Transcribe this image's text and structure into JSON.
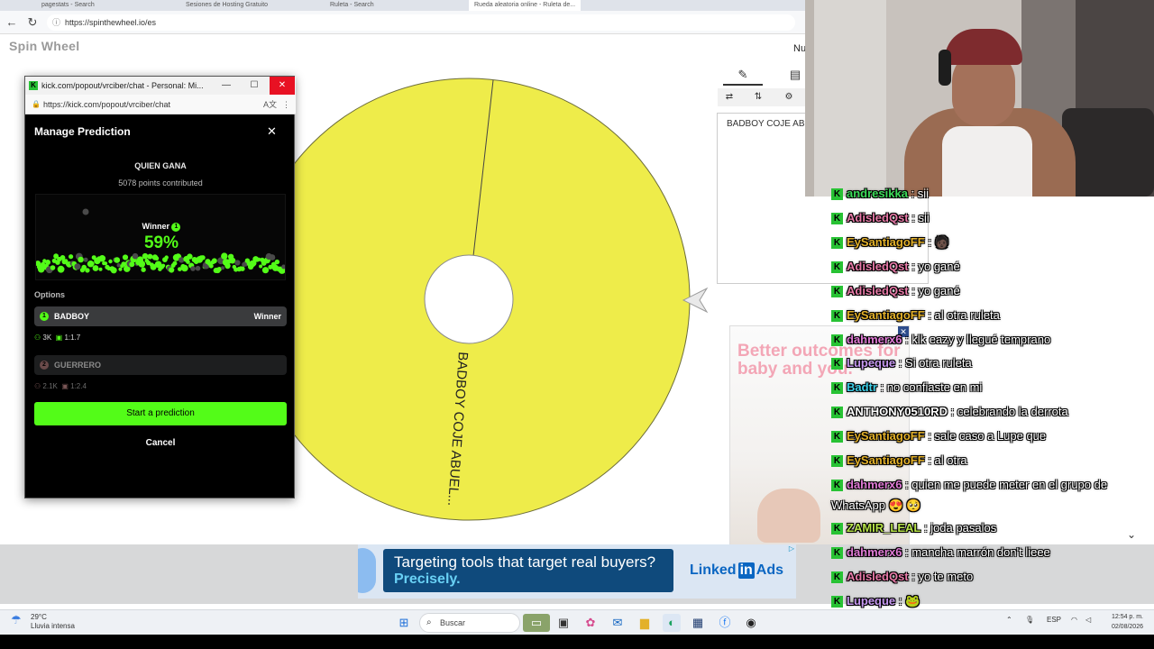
{
  "browser": {
    "url": "https://spinthewheel.io/es",
    "tabs": [
      "pagestats - Search",
      "Sesiones de Hosting Gratuito",
      "Ruleta - Search",
      "Rueda aleatoria online - Ruleta de..."
    ]
  },
  "page": {
    "logo": "Spin Wheel",
    "header_right": "Nu",
    "wheel_segment_label": "BADBOY COJE ABUEL...",
    "entries_text": "BADBOY COJE ABU",
    "wheel_color": "#eeec4a"
  },
  "popout": {
    "window_title": "kick.com/popout/vrciber/chat - Personal: Mi...",
    "address": "https://kick.com/popout/vrciber/chat",
    "heading": "Manage Prediction",
    "question": "QUIEN GANA",
    "points": "5078 points contributed",
    "winner_label": "Winner",
    "winner_badge": "1",
    "percent": "59%",
    "options_label": "Options",
    "options": [
      {
        "badge": "1",
        "name": "BADBOY",
        "status": "Winner",
        "users": "3K",
        "ratio": "1:1.7"
      },
      {
        "badge": "2",
        "name": "GUERRERO",
        "status": "",
        "users": "2.1K",
        "ratio": "1:2.4"
      }
    ],
    "start_button": "Start a prediction",
    "cancel_button": "Cancel",
    "accent": "#53fc18"
  },
  "ads": {
    "right_text": "Better outcomes for baby and you.",
    "bottom_line1": "Targeting tools that target real buyers?",
    "bottom_line2": "Precisely.",
    "bottom_brand_a": "Linked",
    "bottom_brand_in": "in",
    "bottom_brand_b": "Ads"
  },
  "chat": {
    "messages": [
      {
        "user": "andresikka",
        "color": "#3ddc5a",
        "text": ": sii"
      },
      {
        "user": "AdisledQst",
        "color": "#e87aa8",
        "text": ": sii"
      },
      {
        "user": "EySantiagoFF",
        "color": "#e3b12a",
        "text": ": 🧑🏿"
      },
      {
        "user": "AdisledQst",
        "color": "#e87aa8",
        "text": ": yo gané"
      },
      {
        "user": "AdisledQst",
        "color": "#e87aa8",
        "text": ": yo gané"
      },
      {
        "user": "EySantiagoFF",
        "color": "#e3b12a",
        "text": ": al otra ruleta"
      },
      {
        "user": "dahmerx6",
        "color": "#e07bd6",
        "text": ": klk eazy y llegué temprano"
      },
      {
        "user": "Lupeque",
        "color": "#c89af2",
        "text": ": Si otra ruleta"
      },
      {
        "user": "Badtr",
        "color": "#3fd0e8",
        "text": ": no confiaste en mi"
      },
      {
        "user": "ANTHONY0510RD",
        "color": "#ffffff",
        "text": ": celebrando la derrota"
      },
      {
        "user": "EySantiagoFF",
        "color": "#e3b12a",
        "text": ": sale caso a Lupe que"
      },
      {
        "user": "EySantiagoFF",
        "color": "#e3b12a",
        "text": ": al otra"
      },
      {
        "user": "dahmerx6",
        "color": "#e07bd6",
        "text": ": quien me puede meter en el grupo de"
      },
      {
        "user": "",
        "color": "#ffffff",
        "text": "WhatsApp 😍 🥺"
      },
      {
        "user": "ZAMIR_LEAL",
        "color": "#b7e34a",
        "text": ": joda pasalos"
      },
      {
        "user": "dahmerx6",
        "color": "#e07bd6",
        "text": ": mancha marrón don't lieee"
      },
      {
        "user": "AdisledQst",
        "color": "#e87aa8",
        "text": ": yo te meto"
      },
      {
        "user": "Lupeque",
        "color": "#c89af2",
        "text": ": 🐸"
      }
    ]
  },
  "taskbar": {
    "temp": "29°C",
    "weather": "Lluvia intensa",
    "search": "Buscar",
    "lang": "ESP",
    "time": "12:54 p. m.",
    "date": "02/08/2026"
  }
}
